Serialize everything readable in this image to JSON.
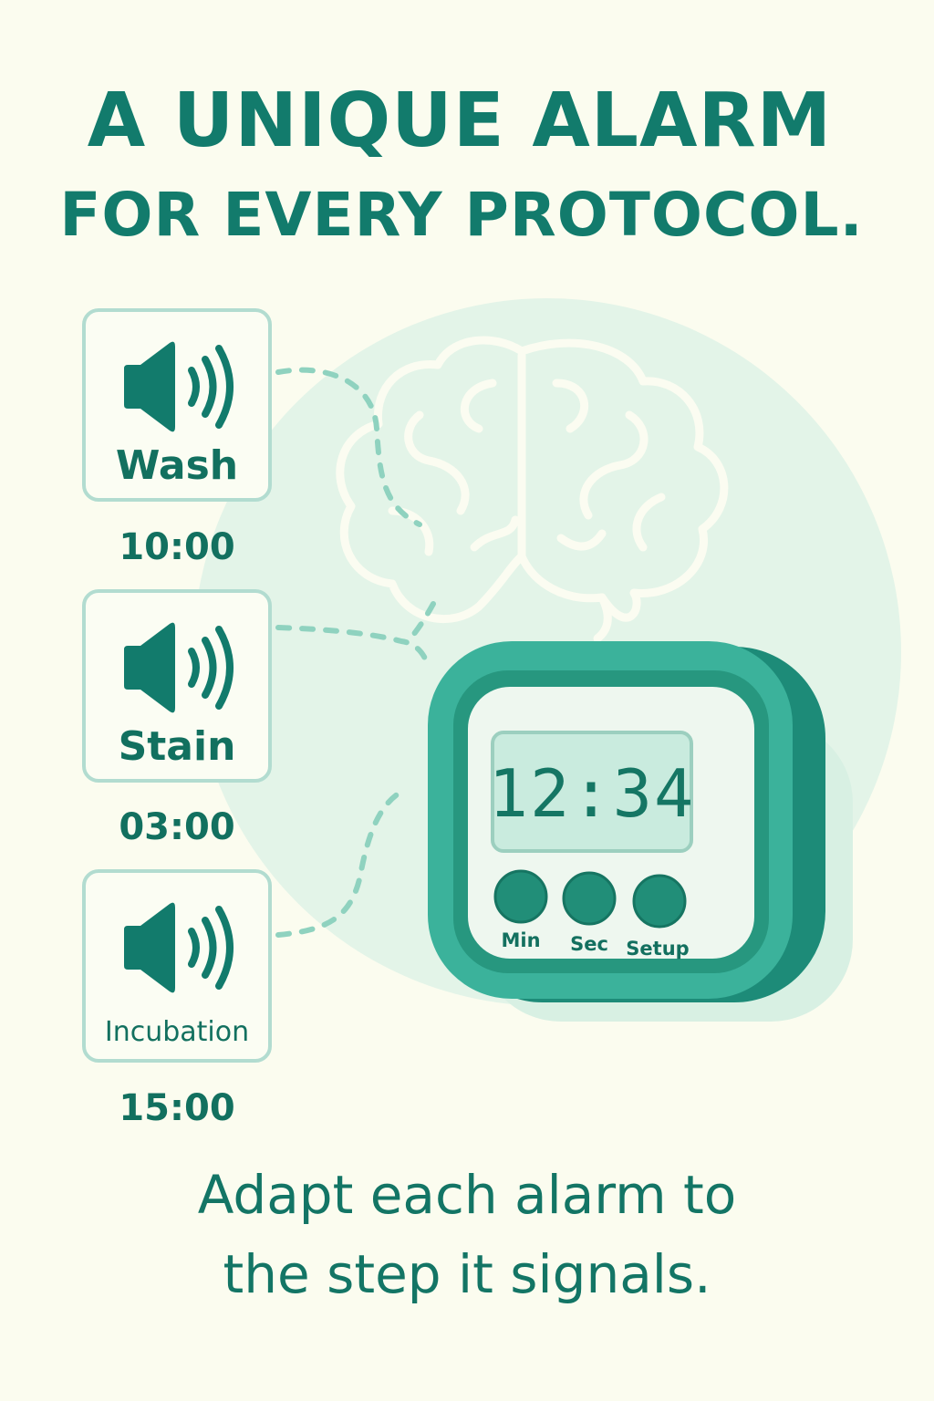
{
  "headline": {
    "line1": "A UNIQUE ALARM",
    "line2": "FOR EVERY PROTOCOL."
  },
  "alarms": [
    {
      "label": "Wash",
      "time": "10:00",
      "icon": "speaker-icon"
    },
    {
      "label": "Stain",
      "time": "03:00",
      "icon": "speaker-icon"
    },
    {
      "label": "Incubation",
      "time": "15:00",
      "icon": "speaker-icon"
    }
  ],
  "timer": {
    "display": "12:34",
    "buttons": [
      "Min",
      "Sec",
      "Setup"
    ]
  },
  "tagline": {
    "line1": "Adapt each alarm to",
    "line2": "the step it signals."
  },
  "colors": {
    "background": "#fbfcef",
    "primary_teal": "#127b6c",
    "timer_body": "#3bb29b",
    "timer_dark": "#1d8b78",
    "screen": "#c9ebde",
    "circle_bg": "#e3f4e8",
    "card_border": "#b2dcd0"
  }
}
